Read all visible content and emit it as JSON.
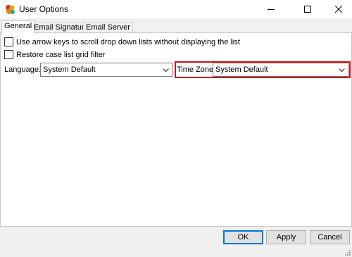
{
  "window": {
    "title": "User Options",
    "icon": "app-icon",
    "controls": [
      "minimize-icon",
      "maximize-icon",
      "close-icon"
    ]
  },
  "tabs": [
    {
      "label": "General",
      "active": true
    },
    {
      "label": "Email Signature",
      "active": false
    },
    {
      "label": "Email Server",
      "active": false
    }
  ],
  "general": {
    "checkbox_arrow_keys": {
      "label": "Use arrow keys to scroll drop down lists without displaying the list",
      "checked": false
    },
    "checkbox_restore_filter": {
      "label": "Restore case list grid filter",
      "checked": false
    },
    "language": {
      "label": "Language:",
      "value": "System Default"
    },
    "time_zone": {
      "label": "Time Zone:",
      "value": "System Default"
    }
  },
  "buttons": {
    "ok": "OK",
    "apply": "Apply",
    "cancel": "Cancel"
  },
  "colors": {
    "highlight": "#d0101c",
    "default_button_border": "#0078d7"
  }
}
